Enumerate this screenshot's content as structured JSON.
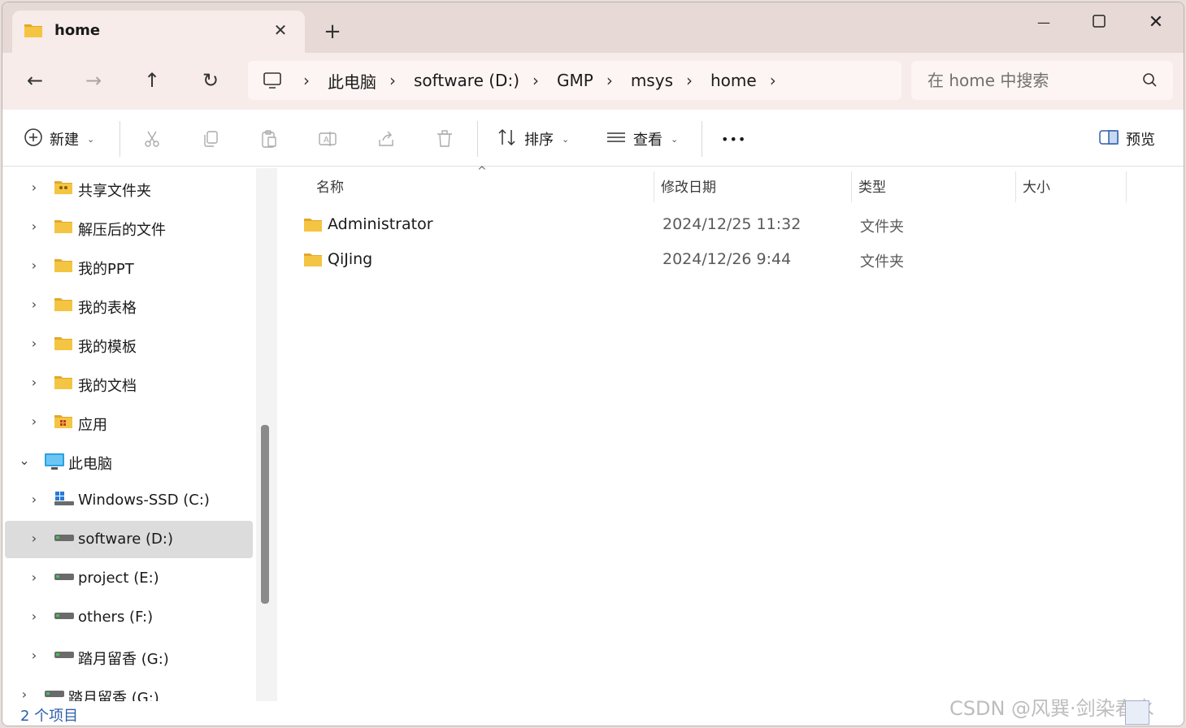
{
  "titlebar": {
    "tab_title": "home",
    "new_tab_symbol": "+",
    "close_tab_symbol": "✕",
    "minimize_symbol": "—",
    "maximize_symbol": "☐",
    "close_window_symbol": "✕"
  },
  "nav": {
    "back_symbol": "←",
    "forward_symbol": "→",
    "up_symbol": "↑",
    "refresh_symbol": "↻"
  },
  "address": {
    "chevron": "›",
    "segments": [
      "此电脑",
      "software (D:)",
      "GMP",
      "msys",
      "home"
    ]
  },
  "search": {
    "placeholder": "在 home 中搜索"
  },
  "commands": {
    "new_label": "新建",
    "sort_label": "排序",
    "view_label": "查看",
    "more_symbol": "•••",
    "preview_label": "预览",
    "caret": "⌄"
  },
  "sidebar": {
    "items": [
      {
        "label": "共享文件夹",
        "icon": "shared-folder-icon",
        "chevron": "›"
      },
      {
        "label": "解压后的文件",
        "icon": "folder-icon",
        "chevron": "›"
      },
      {
        "label": "我的PPT",
        "icon": "folder-icon",
        "chevron": "›"
      },
      {
        "label": "我的表格",
        "icon": "folder-icon",
        "chevron": "›"
      },
      {
        "label": "我的模板",
        "icon": "folder-icon",
        "chevron": "›"
      },
      {
        "label": "我的文档",
        "icon": "folder-icon",
        "chevron": "›"
      },
      {
        "label": "应用",
        "icon": "apps-folder-icon",
        "chevron": "›"
      },
      {
        "label": "此电脑",
        "icon": "this-pc-icon",
        "chevron": "⌄"
      },
      {
        "label": "Windows-SSD (C:)",
        "icon": "windows-drive-icon",
        "chevron": "›"
      },
      {
        "label": "software (D:)",
        "icon": "drive-icon",
        "chevron": "›",
        "selected": true
      },
      {
        "label": "project (E:)",
        "icon": "drive-icon",
        "chevron": "›"
      },
      {
        "label": "others (F:)",
        "icon": "drive-icon",
        "chevron": "›"
      },
      {
        "label": "踏月留香 (G:)",
        "icon": "drive-icon",
        "chevron": "›"
      },
      {
        "label": "踏月留香 (G:)",
        "icon": "drive-icon",
        "chevron": "›"
      }
    ]
  },
  "list": {
    "columns": {
      "name": "名称",
      "date": "修改日期",
      "type": "类型",
      "size": "大小"
    },
    "sort_indicator": "^",
    "rows": [
      {
        "name": "Administrator",
        "date": "2024/12/25 11:32",
        "type": "文件夹"
      },
      {
        "name": "QiJing",
        "date": "2024/12/26 9:44",
        "type": "文件夹"
      }
    ]
  },
  "status": {
    "item_count": "2 个项目"
  },
  "watermark": "CSDN @风巽·剑染春水",
  "colors": {
    "folder": "#f4c542",
    "folder_dark": "#e2a72a",
    "accent": "#2d5eaa"
  }
}
